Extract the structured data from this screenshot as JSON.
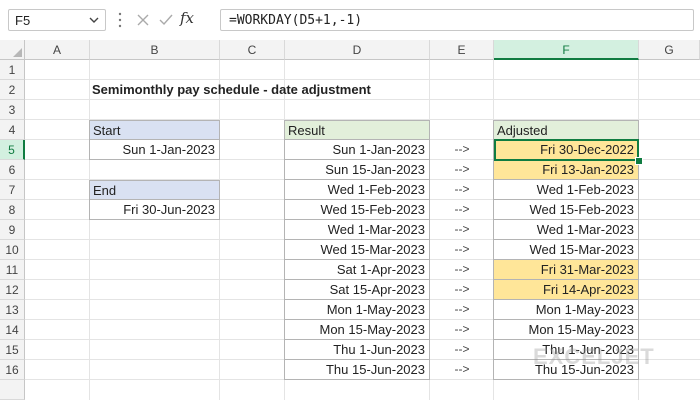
{
  "formula_bar": {
    "name_box": "F5",
    "fx_label": "fx",
    "formula": "=WORKDAY(D5+1,-1)"
  },
  "columns": [
    "A",
    "B",
    "C",
    "D",
    "E",
    "F",
    "G"
  ],
  "rows": [
    "1",
    "2",
    "3",
    "4",
    "5",
    "6",
    "7",
    "8",
    "9",
    "10",
    "11",
    "12",
    "13",
    "14",
    "15",
    "16"
  ],
  "sheet": {
    "title": "Semimonthly pay schedule - date adjustment",
    "start_label": "Start",
    "start_value": "Sun 1-Jan-2023",
    "end_label": "End",
    "end_value": "Fri 30-Jun-2023",
    "result_label": "Result",
    "adjusted_label": "Adjusted",
    "arrow": "-->",
    "results": [
      "Sun 1-Jan-2023",
      "Sun 15-Jan-2023",
      "Wed 1-Feb-2023",
      "Wed 15-Feb-2023",
      "Wed 1-Mar-2023",
      "Wed 15-Mar-2023",
      "Sat 1-Apr-2023",
      "Sat 15-Apr-2023",
      "Mon 1-May-2023",
      "Mon 15-May-2023",
      "Thu 1-Jun-2023",
      "Thu 15-Jun-2023"
    ],
    "adjusted": [
      "Fri 30-Dec-2022",
      "Fri 13-Jan-2023",
      "Wed 1-Feb-2023",
      "Wed 15-Feb-2023",
      "Wed 1-Mar-2023",
      "Wed 15-Mar-2023",
      "Fri 31-Mar-2023",
      "Fri 14-Apr-2023",
      "Mon 1-May-2023",
      "Mon 15-May-2023",
      "Thu 1-Jun-2023",
      "Thu 15-Jun-2023"
    ],
    "highlighted_rows": [
      0,
      1,
      6,
      7
    ],
    "highlight_color": "#ffe699"
  },
  "watermark": "EXCELJET"
}
